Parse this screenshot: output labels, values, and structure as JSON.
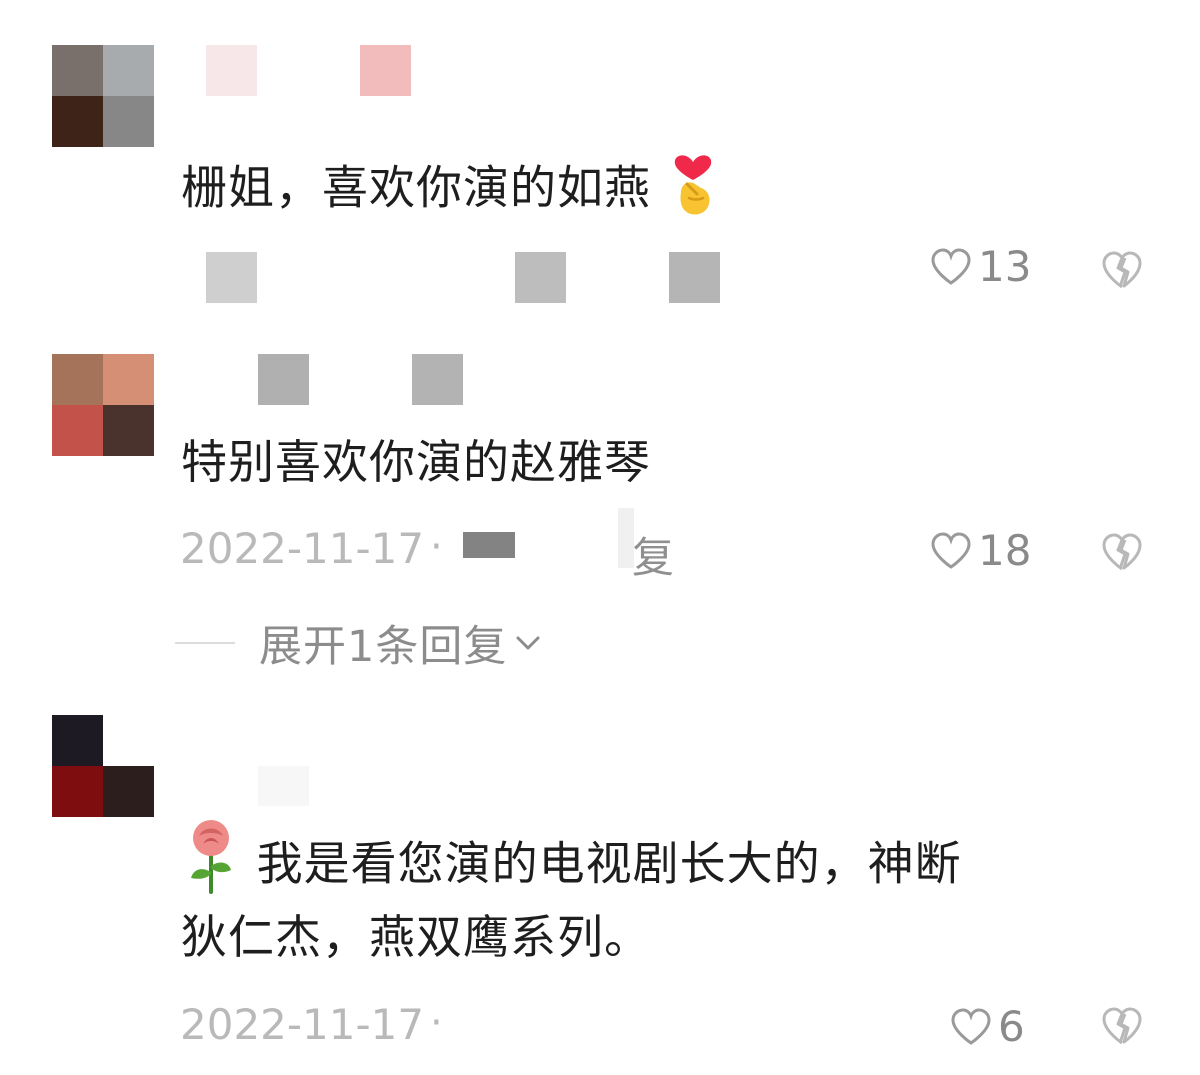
{
  "comments": [
    {
      "text": "栅姐，喜欢你演的如燕",
      "emoji": "finger-heart-icon",
      "date": "",
      "likes": "13"
    },
    {
      "text": "特别喜欢你演的赵雅琴",
      "date": "2022-11-17",
      "reply_label": "复",
      "likes": "18",
      "expand_label": "展开1条回复"
    },
    {
      "emoji": "rose-icon",
      "text_line1": "我是看您演的电视剧长大的，神断",
      "text_line2": "狄仁杰，燕双鹰系列。",
      "date": "2022-11-17",
      "likes": "6"
    }
  ],
  "separator": "·",
  "colors": {
    "text": "#1e1e1e",
    "meta": "#b9b9b9",
    "icon": "#b8b8b8"
  }
}
